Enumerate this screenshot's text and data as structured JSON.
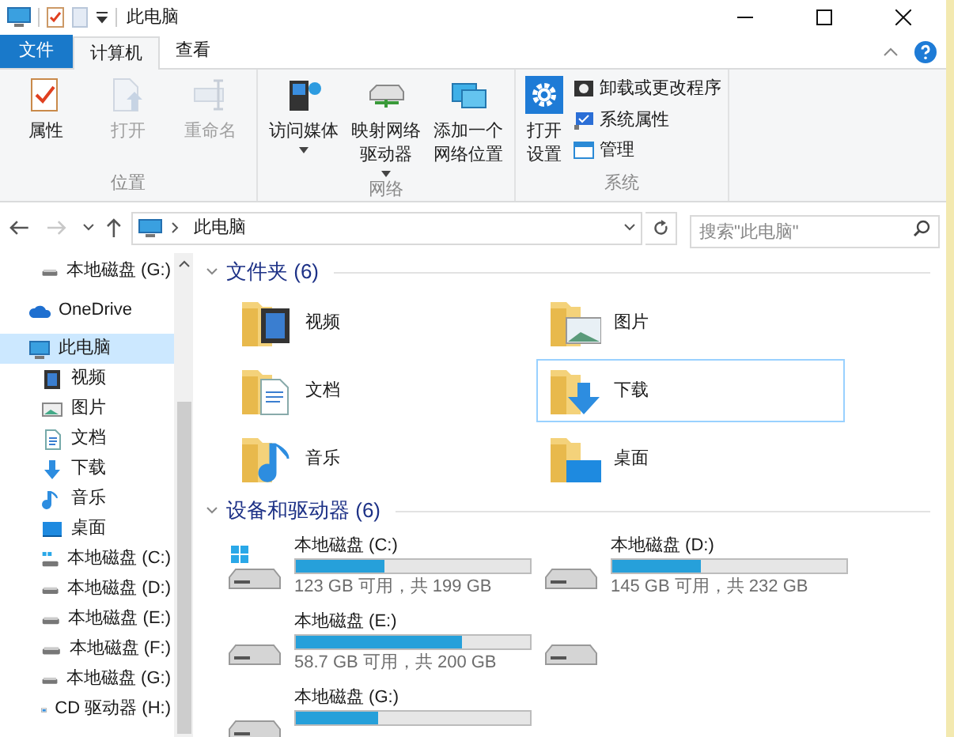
{
  "window": {
    "title": "此电脑"
  },
  "ribbon_tabs": [
    {
      "label": "文件",
      "kind": "file",
      "selected": false
    },
    {
      "label": "计算机",
      "kind": "tab",
      "selected": true
    },
    {
      "label": "查看",
      "kind": "tab",
      "selected": false
    }
  ],
  "ribbon_groups": [
    {
      "label": "位置",
      "buttons": [
        {
          "label": "属性",
          "kind": "properties",
          "disabled": false
        },
        {
          "label": "打开",
          "kind": "open",
          "disabled": true
        },
        {
          "label": "重命名",
          "kind": "rename",
          "disabled": true
        }
      ]
    },
    {
      "label": "网络",
      "buttons": [
        {
          "label": "访问媒体",
          "kind": "media",
          "disabled": false,
          "dropdown": true
        },
        {
          "label": "映射网络驱动器",
          "kind": "netdrive",
          "disabled": false,
          "dropdown": true
        },
        {
          "label": "添加一个网络位置",
          "kind": "netplace",
          "disabled": false
        }
      ]
    },
    {
      "label": "系统",
      "buttons": [
        {
          "label": "打开设置",
          "kind": "settings",
          "disabled": false
        }
      ],
      "small_buttons": [
        {
          "label": "卸载或更改程序",
          "kind": "uninstall"
        },
        {
          "label": "系统属性",
          "kind": "sysprops"
        },
        {
          "label": "管理",
          "kind": "manage"
        }
      ]
    }
  ],
  "address_bar": {
    "forward_disabled": true,
    "path": "此电脑"
  },
  "search": {
    "placeholder": "搜索\"此电脑\""
  },
  "nav": {
    "items": [
      {
        "children": [
          {
            "label": "本地磁盘 (G:)",
            "kind": "drive",
            "selected": false
          }
        ]
      },
      {
        "label": "OneDrive",
        "kind": "cloud",
        "selected": false
      },
      {
        "label": "此电脑",
        "kind": "pc",
        "selected": true,
        "children": [
          {
            "label": "视频",
            "kind": "video",
            "selected": false
          },
          {
            "label": "图片",
            "kind": "picture",
            "selected": false
          },
          {
            "label": "文档",
            "kind": "document",
            "selected": false
          },
          {
            "label": "下载",
            "kind": "download",
            "selected": false
          },
          {
            "label": "音乐",
            "kind": "music",
            "selected": false
          },
          {
            "label": "桌面",
            "kind": "desktop",
            "selected": false
          },
          {
            "label": "本地磁盘 (C:)",
            "kind": "windrive",
            "selected": false
          },
          {
            "label": "本地磁盘 (D:)",
            "kind": "drive",
            "selected": false
          },
          {
            "label": "本地磁盘 (E:)",
            "kind": "drive",
            "selected": false
          },
          {
            "label": "本地磁盘 (F:)",
            "kind": "drive",
            "selected": false
          },
          {
            "label": "本地磁盘 (G:)",
            "kind": "drive",
            "selected": false
          },
          {
            "label": "CD 驱动器 (H:)",
            "kind": "cd",
            "selected": false
          }
        ]
      }
    ]
  },
  "folders": {
    "title": "文件夹 (6)",
    "items": [
      {
        "label": "视频",
        "kind": "video",
        "selected": false
      },
      {
        "label": "图片",
        "kind": "picture",
        "selected": false
      },
      {
        "label": "文档",
        "kind": "document",
        "selected": false
      },
      {
        "label": "下载",
        "kind": "download",
        "selected": true
      },
      {
        "label": "音乐",
        "kind": "music",
        "selected": false
      },
      {
        "label": "桌面",
        "kind": "desktop",
        "selected": false
      }
    ]
  },
  "drives": {
    "title": "设备和驱动器 (6)",
    "items": [
      {
        "kind": "windrive",
        "name": "本地磁盘 (C:)",
        "level": 0.38,
        "free": "123 GB 可用，共 199 GB"
      },
      {
        "kind": "drive",
        "name": "本地磁盘 (D:)",
        "level": 0.375,
        "free": "145 GB 可用，共 232 GB"
      },
      {
        "kind": "drive",
        "name": "本地磁盘 (E:)",
        "level": 0.71,
        "free": "58.7 GB 可用，共 200 GB"
      },
      {
        "kind": "drive"
      },
      {
        "kind": "drive",
        "name": "本地磁盘 (G:)",
        "level": 0.35
      }
    ]
  }
}
